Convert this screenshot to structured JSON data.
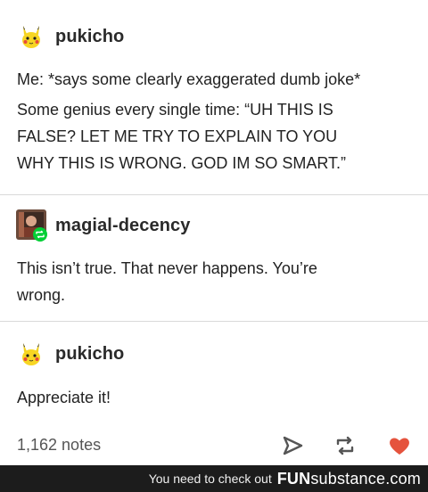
{
  "posts": [
    {
      "username": "pukicho",
      "avatar_icon": "pikachu-avatar-icon",
      "lines": [
        "Me: *says some clearly exaggerated dumb joke*",
        "Some genius every single time: “UH THIS IS",
        "FALSE? LET ME TRY TO EXPLAIN TO YOU",
        "WHY THIS IS WRONG. GOD IM SO SMART.”"
      ]
    },
    {
      "username": "magial-decency",
      "avatar_icon": "profile-avatar-icon",
      "badge_icon": "reblog-badge-icon",
      "lines": [
        "This isn’t true. That never happens. You’re",
        "wrong."
      ]
    },
    {
      "username": "pukicho",
      "avatar_icon": "pikachu-avatar-icon",
      "lines": [
        "Appreciate it!"
      ]
    }
  ],
  "footer": {
    "notes": "1,162 notes",
    "icons": [
      "share-icon",
      "reblog-icon",
      "heart-icon"
    ],
    "heart_color": "#e5533d"
  },
  "watermark": {
    "text": "You need to check out",
    "brand_fun": "FUN",
    "brand_substance": "substance",
    "brand_tld": ".com"
  }
}
